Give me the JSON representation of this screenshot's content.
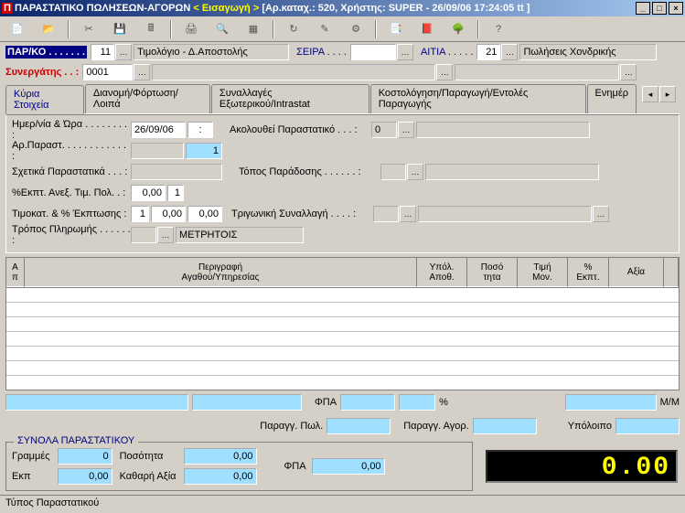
{
  "title": {
    "app_icon": "Π",
    "main": "ΠΑΡΑΣΤΑΤΙΚΟ ΠΩΛΗΣΕΩΝ-ΑΓΟΡΩΝ",
    "mode": "< Εισαγωγή >",
    "context": "[Αρ.καταχ.: 520, Χρήστης: SUPER - 26/09/06 17:24:05 tt ]"
  },
  "winbtn": {
    "min": "_",
    "max": "□",
    "close": "×"
  },
  "header": {
    "parko_label": "ΠΑΡ/ΚΟ . . . . . . .",
    "parko_code": "11",
    "parko_desc": "Τιμολόγιο - Δ.Αποστολής",
    "seira_label": "ΣΕΙΡΑ . . . .",
    "seira_val": "",
    "aitia_label": "ΑΙΤΙΑ . . . . .",
    "aitia_code": "21",
    "aitia_desc": "Πωλήσεις Χονδρικής",
    "synergatis_label": "Συνεργάτης . . :",
    "synergatis_code": "0001"
  },
  "tabs": {
    "t1": "Κύρια Στοιχεία",
    "t2": "Διανομή/Φόρτωση/Λοιπά",
    "t3": "Συναλλαγές Εξωτερικού/Intrastat",
    "t4": "Κοστολόγηση/Παραγωγή/Εντολές Παραγωγής",
    "t5": "Ενημέρ"
  },
  "form": {
    "date_label": "Ημερ/νία & Ώρα . . . . . . . . :",
    "date_val": "26/09/06",
    "time_val": ":",
    "follow_label": "Ακολουθεί Παραστατικό . . .  :",
    "follow_val": "0",
    "arparast_label": "Αρ.Παραστ. . . . . . . . . . . . :",
    "arparast_val": "1",
    "related_label": "Σχετικά Παραστατικά . . .  :",
    "topos_label": "Τόπος Παράδοσης . . . . . . :",
    "ekpt_label": "%Εκπτ. Ανεξ. Τιμ. Πολ. . :",
    "ekpt_v1": "0,00",
    "ekpt_v2": "1",
    "timokat_label": "Τιμοκατ. & % Έκπτωσης  :",
    "timokat_v1": "1",
    "timokat_v2": "0,00",
    "timokat_v3": "0,00",
    "trig_label": "Τριγωνική Συναλλαγή . . . . :",
    "tropos_label": "Τρόπος Πληρωμής . . . . . . :",
    "tropos_desc": "ΜΕΤΡΗΤΟΙΣ"
  },
  "grid": {
    "h_an": "Α\nπ",
    "h_desc": "Περιγραφή\nΑγαθού/Υπηρεσίας",
    "h_ypol": "Υπόλ.\nΑποθ.",
    "h_posot": "Ποσό\nτητα",
    "h_timi": "Τιμή\nΜον.",
    "h_ekpt": "%\nΕκπτ.",
    "h_axia": "Αξία"
  },
  "summary": {
    "fpa_lbl": "ΦΠΑ",
    "pct_lbl": "%",
    "mm_lbl": "Μ/Μ",
    "paragg_pol_lbl": "Παραγγ. Πωλ.",
    "paragg_agor_lbl": "Παραγγ. Αγορ.",
    "ypoloipo_lbl": "Υπόλοιπο"
  },
  "totals": {
    "legend": "ΣΥΝΟΛΑ ΠΑΡΑΣΤΑΤΙΚΟΥ",
    "grammes_lbl": "Γραμμές",
    "grammes_val": "0",
    "posotita_lbl": "Ποσότητα",
    "posotita_val": "0,00",
    "ekp_lbl": "Εκπ",
    "ekp_val": "0,00",
    "kathari_lbl": "Καθαρή Αξία",
    "kathari_val": "0,00",
    "fpa_lbl": "ΦΠΑ",
    "fpa_val": "0,00",
    "lcd": "0.00"
  },
  "status": {
    "text": "Τύπος Παραστατικού"
  }
}
